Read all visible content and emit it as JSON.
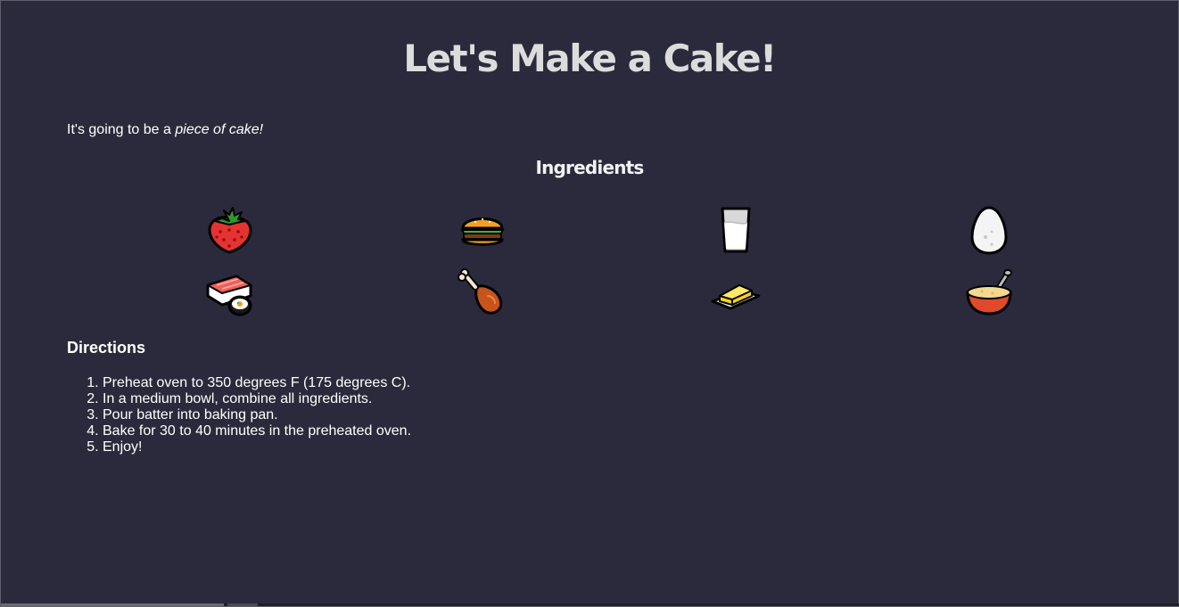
{
  "page": {
    "title": "Let's Make a Cake!",
    "intro_prefix": "It's going to be a ",
    "intro_emphasis": "piece of cake!"
  },
  "ingredients": {
    "title": "Ingredients",
    "items": [
      {
        "icon": "strawberry-icon"
      },
      {
        "icon": "hamburger-icon"
      },
      {
        "icon": "glass-of-milk-icon"
      },
      {
        "icon": "egg-icon"
      },
      {
        "icon": "sushi-icon"
      },
      {
        "icon": "poultry-leg-icon"
      },
      {
        "icon": "butter-icon"
      },
      {
        "icon": "bowl-with-spoon-icon"
      }
    ]
  },
  "directions": {
    "title": "Directions",
    "steps": [
      "Preheat oven to 350 degrees F (175 degrees C).",
      "In a medium bowl, combine all ingredients.",
      "Pour batter into baking pan.",
      "Bake for 30 to 40 minutes in the preheated oven.",
      "Enjoy!"
    ]
  },
  "colors": {
    "background": "#2b2a3c",
    "title": "#dcdcdc",
    "text": "#ffffff"
  }
}
